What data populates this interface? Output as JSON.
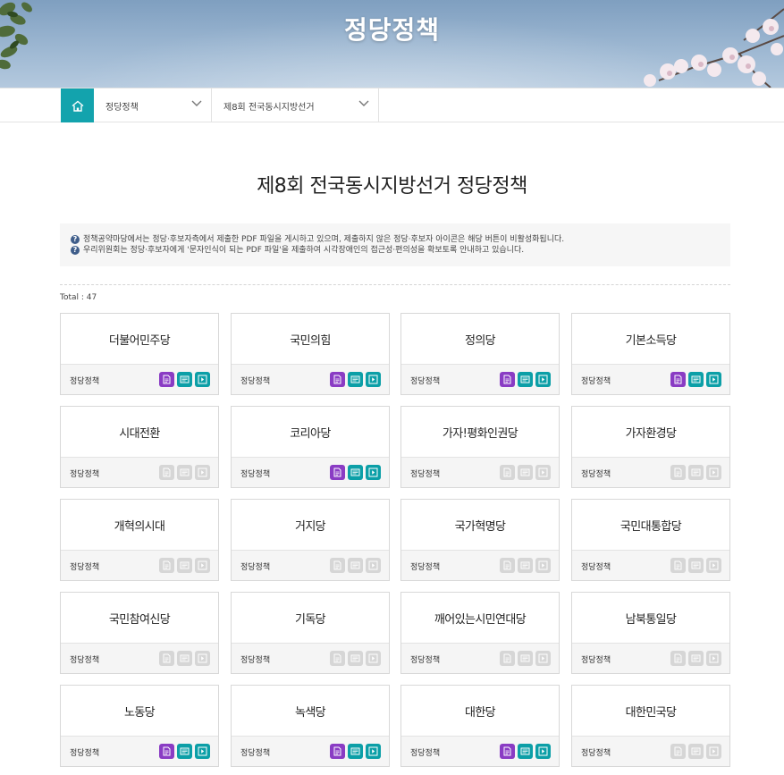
{
  "header": {
    "title": "정당정책"
  },
  "subnav": {
    "home_icon": "home-icon",
    "dropdown1": "정당정책",
    "dropdown2": "제8회 전국동시지방선거"
  },
  "page_title": "제8회 전국동시지방선거 정당정책",
  "notice": {
    "line1": "정책공약마당에서는 정당·후보자측에서 제출한 PDF 파일을 게시하고 있으며, 제출하지 않은 정당·후보자 아이콘은 해당 버튼이 비활성화됩니다.",
    "line2": "우리위원회는 정당·후보자에게 '문자인식이 되는 PDF 파일'을 제출하여 시각장애인의 접근성·편의성을 확보토록 안내하고 있습니다."
  },
  "total": "Total : 47",
  "colors": {
    "accent": "#13a3ad",
    "pdf_active": "#8a3cc4",
    "teal_active": "#0c9fa7",
    "disabled": "#d6d6d6"
  },
  "parties": [
    {
      "name": "더불어민주당",
      "label": "정당정책",
      "active": true
    },
    {
      "name": "국민의힘",
      "label": "정당정책",
      "active": true
    },
    {
      "name": "정의당",
      "label": "정당정책",
      "active": true
    },
    {
      "name": "기본소득당",
      "label": "정당정책",
      "active": true
    },
    {
      "name": "시대전환",
      "label": "정당정책",
      "active": false
    },
    {
      "name": "코리아당",
      "label": "정당정책",
      "active": true
    },
    {
      "name": "가자!평화인권당",
      "label": "정당정책",
      "active": false
    },
    {
      "name": "가자환경당",
      "label": "정당정책",
      "active": false
    },
    {
      "name": "개혁의시대",
      "label": "정당정책",
      "active": false
    },
    {
      "name": "거지당",
      "label": "정당정책",
      "active": false
    },
    {
      "name": "국가혁명당",
      "label": "정당정책",
      "active": false
    },
    {
      "name": "국민대통합당",
      "label": "정당정책",
      "active": false
    },
    {
      "name": "국민참여신당",
      "label": "정당정책",
      "active": false
    },
    {
      "name": "기독당",
      "label": "정당정책",
      "active": false
    },
    {
      "name": "깨어있는시민연대당",
      "label": "정당정책",
      "active": false
    },
    {
      "name": "남북통일당",
      "label": "정당정책",
      "active": false
    },
    {
      "name": "노동당",
      "label": "정당정책",
      "active": true
    },
    {
      "name": "녹색당",
      "label": "정당정책",
      "active": true
    },
    {
      "name": "대한당",
      "label": "정당정책",
      "active": true
    },
    {
      "name": "대한민국당",
      "label": "정당정책",
      "active": false
    }
  ]
}
